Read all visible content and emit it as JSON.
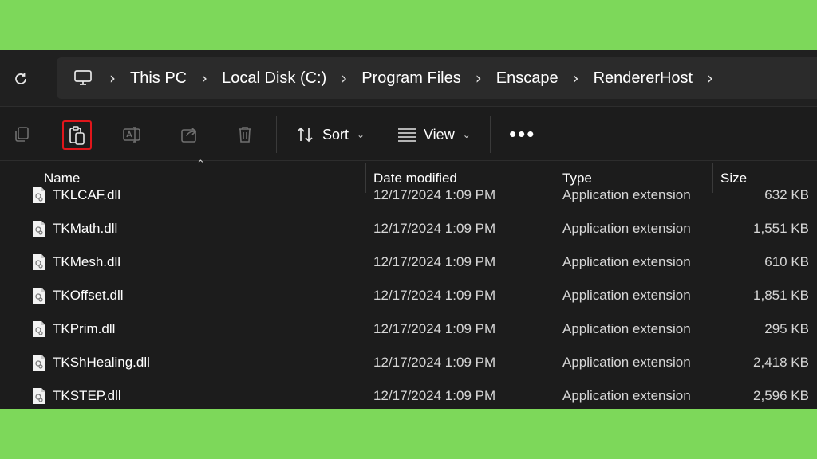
{
  "address_bar": {
    "crumbs": [
      "This PC",
      "Local Disk (C:)",
      "Program Files",
      "Enscape",
      "RendererHost"
    ]
  },
  "toolbar": {
    "sort_label": "Sort",
    "view_label": "View",
    "highlighted_button": "paste"
  },
  "columns": {
    "name": "Name",
    "date": "Date modified",
    "type": "Type",
    "size": "Size"
  },
  "files": [
    {
      "name": "TKLCAF.dll",
      "date": "12/17/2024 1:09 PM",
      "type": "Application extension",
      "size": "632 KB"
    },
    {
      "name": "TKMath.dll",
      "date": "12/17/2024 1:09 PM",
      "type": "Application extension",
      "size": "1,551 KB"
    },
    {
      "name": "TKMesh.dll",
      "date": "12/17/2024 1:09 PM",
      "type": "Application extension",
      "size": "610 KB"
    },
    {
      "name": "TKOffset.dll",
      "date": "12/17/2024 1:09 PM",
      "type": "Application extension",
      "size": "1,851 KB"
    },
    {
      "name": "TKPrim.dll",
      "date": "12/17/2024 1:09 PM",
      "type": "Application extension",
      "size": "295 KB"
    },
    {
      "name": "TKShHealing.dll",
      "date": "12/17/2024 1:09 PM",
      "type": "Application extension",
      "size": "2,418 KB"
    },
    {
      "name": "TKSTEP.dll",
      "date": "12/17/2024 1:09 PM",
      "type": "Application extension",
      "size": "2,596 KB"
    }
  ],
  "colors": {
    "background": "#7dd85a",
    "window": "#1c1c1c",
    "highlight": "#e0161b"
  }
}
